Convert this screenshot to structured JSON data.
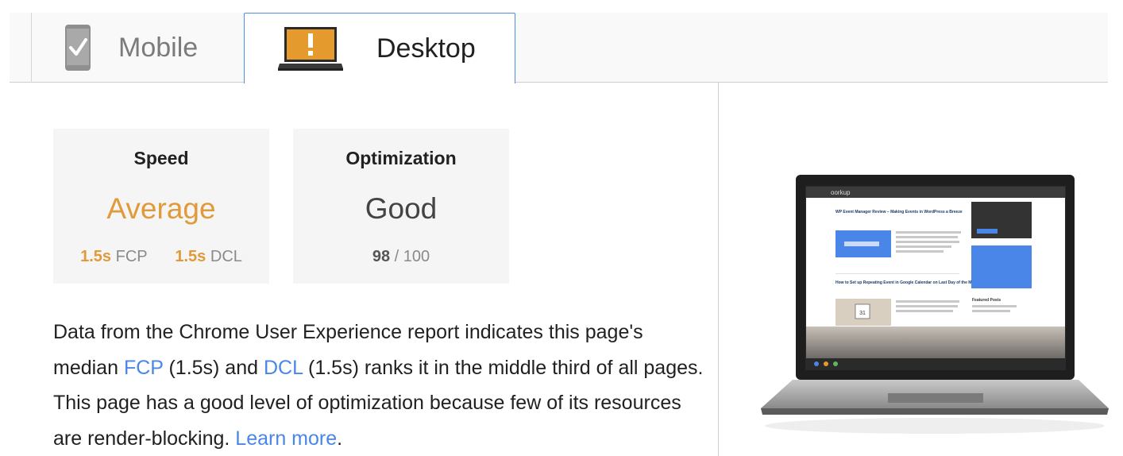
{
  "tabs": [
    {
      "label": "Mobile",
      "icon": "phone-check-icon",
      "active": false
    },
    {
      "label": "Desktop",
      "icon": "laptop-warning-icon",
      "active": true
    }
  ],
  "speed_card": {
    "title": "Speed",
    "rating": "Average",
    "rating_color": "#e09a3a",
    "fcp_value": "1.5s",
    "fcp_label": "FCP",
    "dcl_value": "1.5s",
    "dcl_label": "DCL"
  },
  "optimization_card": {
    "title": "Optimization",
    "rating": "Good",
    "score": "98",
    "score_sep": "/",
    "score_max": "100"
  },
  "description": {
    "part1": "Data from the Chrome User Experience report indicates this page's median ",
    "fcp_link": "FCP",
    "part2": " (1.5s) and ",
    "dcl_link": "DCL",
    "part3": " (1.5s) ranks it in the middle third of all pages. This page has a good level of optimization because few of its resources are render-blocking. ",
    "learn_more": "Learn more",
    "part4": "."
  },
  "colors": {
    "accent_blue": "#4a86e8",
    "average_orange": "#e09a3a",
    "warning_icon": "#e49a2c"
  },
  "preview": {
    "site_logo": "oorkup",
    "post1_title": "WP Event Manager Review – Making Events in WordPress a Breeze",
    "post2_title": "How to Set up Repeating Event in Google Calendar on Last Day of the Month",
    "calendar_day": "31",
    "sidebar_heading": "Featured Posts"
  }
}
